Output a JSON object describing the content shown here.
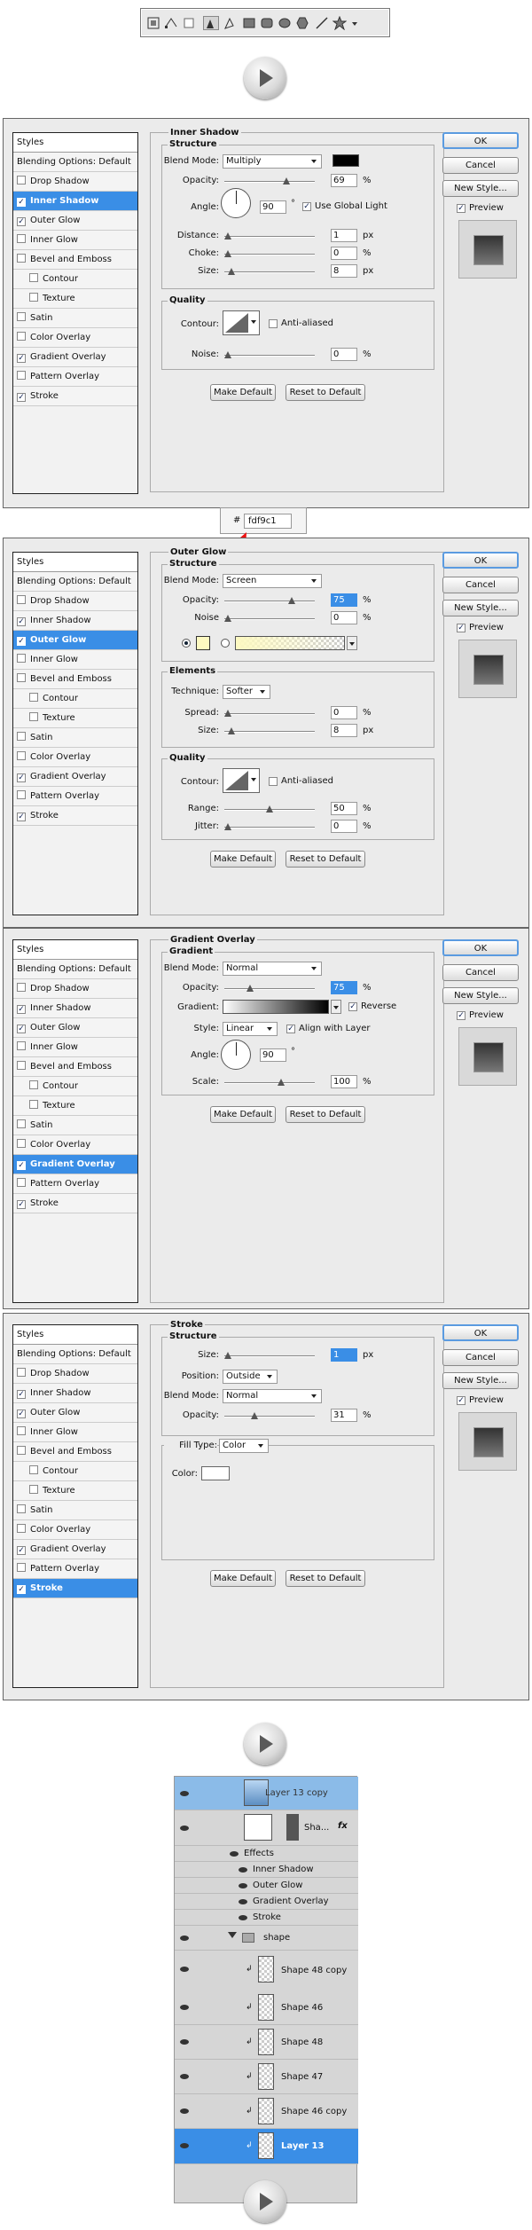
{
  "toolbar": {
    "tools": [
      "shape-layers-icon",
      "paths-icon",
      "fill-pixels-icon",
      "pen-icon",
      "freeform-pen-icon",
      "rectangle-icon",
      "rounded-rectangle-icon",
      "ellipse-icon",
      "polygon-icon",
      "line-icon",
      "custom-shape-icon",
      "chevron-down-icon"
    ]
  },
  "common": {
    "styles_header": "Styles",
    "items": [
      "Blending Options: Default",
      "Drop Shadow",
      "Inner Shadow",
      "Outer Glow",
      "Inner Glow",
      "Bevel and Emboss",
      "Contour",
      "Texture",
      "Satin",
      "Color Overlay",
      "Gradient Overlay",
      "Pattern Overlay",
      "Stroke"
    ],
    "ok": "OK",
    "cancel": "Cancel",
    "new_style": "New Style...",
    "preview": "Preview",
    "make_default": "Make Default",
    "reset_default": "Reset to Default",
    "structure": "Structure",
    "quality": "Quality",
    "elements": "Elements",
    "blend_mode_label": "Blend Mode:",
    "opacity_label": "Opacity:",
    "noise_label": "Noise:",
    "contour_label": "Contour:",
    "anti_aliased": "Anti-aliased",
    "percent": "%",
    "px": "px",
    "deg": "°"
  },
  "inner_shadow": {
    "title": "Inner Shadow",
    "blend_mode": "Multiply",
    "opacity": "69",
    "angle_label": "Angle:",
    "angle": "90",
    "use_global_light": "Use Global Light",
    "distance_label": "Distance:",
    "distance": "1",
    "choke_label": "Choke:",
    "choke": "0",
    "size_label": "Size:",
    "size": "8",
    "noise": "0"
  },
  "hex_popup": {
    "hash": "#",
    "value": "fdf9c1"
  },
  "outer_glow": {
    "title": "Outer Glow",
    "blend_mode": "Screen",
    "opacity": "75",
    "noise_label": "Noise",
    "noise": "0",
    "technique_label": "Technique:",
    "technique": "Softer",
    "spread_label": "Spread:",
    "spread": "0",
    "size_label": "Size:",
    "size": "8",
    "range_label": "Range:",
    "range": "50",
    "jitter_label": "Jitter:",
    "jitter": "0"
  },
  "gradient_overlay": {
    "title": "Gradient Overlay",
    "group": "Gradient",
    "blend_mode": "Normal",
    "opacity": "75",
    "gradient_label": "Gradient:",
    "reverse": "Reverse",
    "style_label": "Style:",
    "style": "Linear",
    "align": "Align with Layer",
    "angle_label": "Angle:",
    "angle": "90",
    "scale_label": "Scale:",
    "scale": "100"
  },
  "stroke": {
    "title": "Stroke",
    "size_label": "Size:",
    "size": "1",
    "position_label": "Position:",
    "position": "Outside",
    "blend_mode": "Normal",
    "opacity": "31",
    "fill_type_label": "Fill Type:",
    "fill_type": "Color",
    "color_label": "Color:"
  },
  "layers": {
    "top_layer": "Layer 13 copy",
    "shape_layer": "Sha...",
    "fx": "fx",
    "effects": "Effects",
    "effect_items": [
      "Inner Shadow",
      "Outer Glow",
      "Gradient Overlay",
      "Stroke"
    ],
    "group": "shape",
    "children": [
      "Shape 48 copy",
      "Shape 46",
      "Shape 48",
      "Shape 47",
      "Shape 46 copy",
      "Layer 13"
    ]
  }
}
